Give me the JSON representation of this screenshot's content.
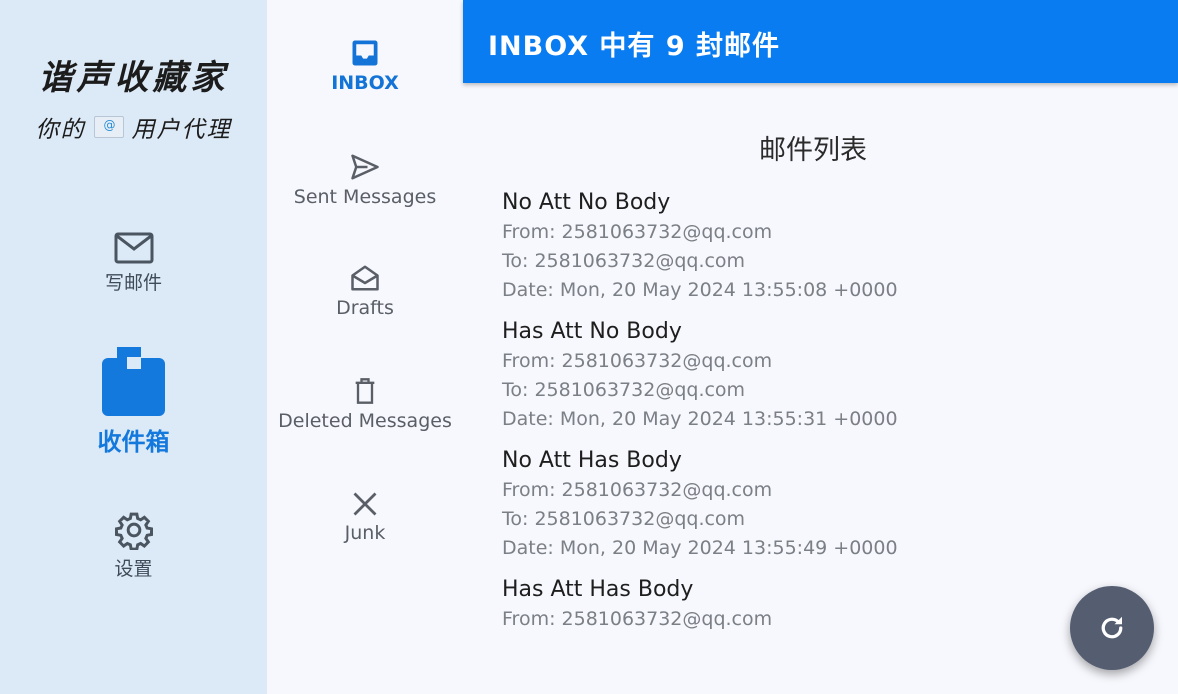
{
  "app": {
    "brand": "谐声收藏家",
    "tagline_prefix": "你的",
    "tagline_suffix": "用户代理"
  },
  "rail": {
    "items": [
      {
        "label": "写邮件",
        "icon": "mail-icon"
      },
      {
        "label": "收件箱",
        "icon": "inbox-icon",
        "active": true
      },
      {
        "label": "设置",
        "icon": "gear-icon"
      }
    ]
  },
  "folders": {
    "items": [
      {
        "label": "INBOX",
        "icon": "inbox-tray-icon",
        "active": true
      },
      {
        "label": "Sent Messages",
        "icon": "send-icon"
      },
      {
        "label": "Drafts",
        "icon": "drafts-icon"
      },
      {
        "label": "Deleted Messages",
        "icon": "trash-icon"
      },
      {
        "label": "Junk",
        "icon": "close-icon"
      }
    ]
  },
  "header": {
    "title": "INBOX 中有 9 封邮件"
  },
  "main": {
    "list_title": "邮件列表",
    "emails": [
      {
        "subject": "No Att No Body",
        "from": "From: 2581063732@qq.com",
        "to": "To: 2581063732@qq.com",
        "date": "Date: Mon, 20 May 2024 13:55:08 +0000"
      },
      {
        "subject": "Has Att No Body",
        "from": "From: 2581063732@qq.com",
        "to": "To: 2581063732@qq.com",
        "date": "Date: Mon, 20 May 2024 13:55:31 +0000"
      },
      {
        "subject": "No Att Has Body",
        "from": "From: 2581063732@qq.com",
        "to": "To: 2581063732@qq.com",
        "date": "Date: Mon, 20 May 2024 13:55:49 +0000"
      },
      {
        "subject": "Has Att Has Body",
        "from": "From: 2581063732@qq.com"
      }
    ]
  },
  "fab": {
    "icon": "refresh-icon"
  },
  "colors": {
    "accent": "#0a7cf2",
    "rail_bg": "#dce9f7",
    "fab_bg": "#555d71",
    "active_text": "#1479dc"
  }
}
